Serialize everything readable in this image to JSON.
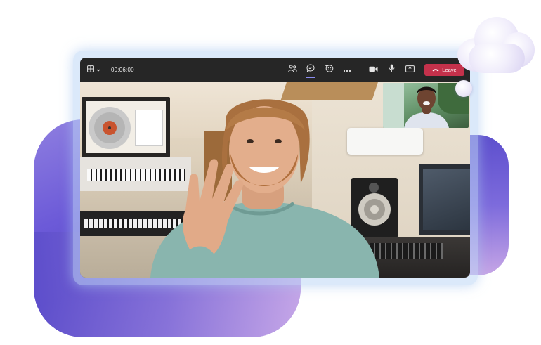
{
  "call": {
    "timer": "00:06:00"
  },
  "toolbar": {
    "layout_icon": "grid-layout-icon",
    "layout_menu_icon": "chevron-down-icon",
    "people_icon": "people-icon",
    "chat_icon": "chat-icon",
    "react_icon": "reactions-icon",
    "more_icon": "more-icon",
    "camera_icon": "camera-icon",
    "mic_icon": "microphone-icon",
    "share_icon": "share-screen-icon",
    "leave_label": "Leave",
    "leave_icon": "phone-hangup-icon"
  },
  "colors": {
    "toolbar_bg": "#262626",
    "leave_red": "#c4314b",
    "active_indicator": "#8b8cf0",
    "blob_purple": "#6c5ad8"
  }
}
